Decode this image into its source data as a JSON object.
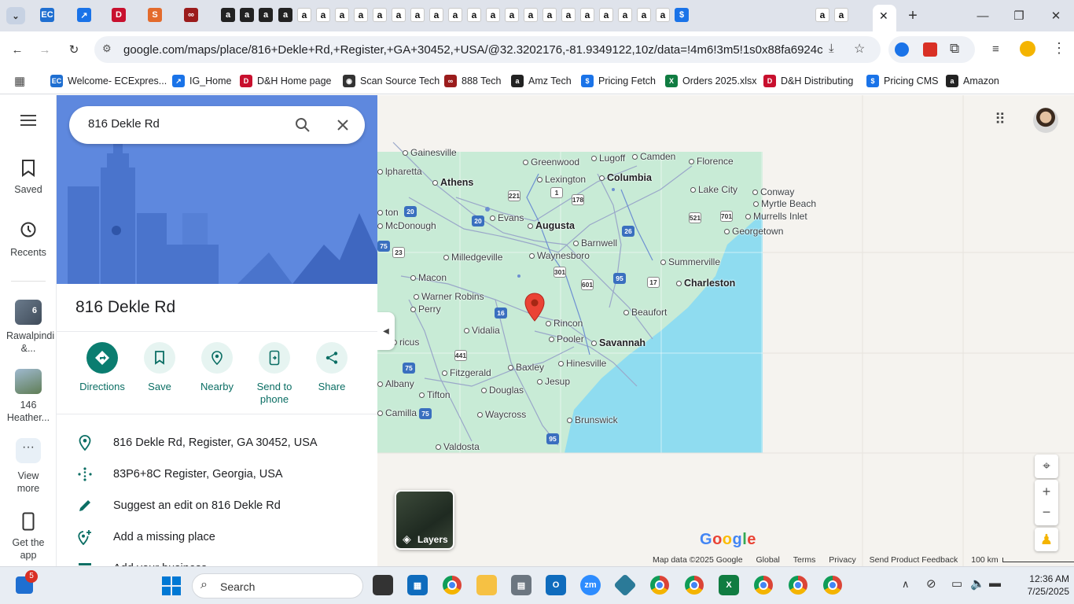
{
  "browser": {
    "tab_favicons": [
      "tab-menu-icon",
      "ec-icon",
      "ig-icon",
      "dh-icon",
      "scansource-icon",
      "888-icon",
      "amazon-icon",
      "amazon-icon",
      "amazon-icon",
      "amazon-icon",
      "amazon-icon",
      "amazon-icon",
      "amazon-icon",
      "amazon-icon",
      "amazon-icon",
      "amazon-icon",
      "amazon-icon",
      "amazon-icon",
      "amazon-icon",
      "amazon-icon",
      "amazon-icon",
      "amazon-icon",
      "amazon-icon",
      "amazon-icon",
      "amazon-icon",
      "amazon-icon",
      "amazon-icon",
      "amazon-icon",
      "amazon-icon",
      "amazon-icon",
      "pricing-icon",
      "amazon-icon",
      "amazon-icon"
    ],
    "url": "google.com/maps/place/816+Dekle+Rd,+Register,+GA+30452,+USA/@32.3202176,-81.9349122,10z/data=!4m6!3m5!1s0x88fa6924ce62d8b3...",
    "bookmarks": [
      {
        "label": "Welcome- ECExpres...",
        "icon": "ec-icon",
        "color": "#1f6fd1"
      },
      {
        "label": "IG_Home",
        "icon": "ig-icon",
        "color": "#1a73e8"
      },
      {
        "label": "D&H Home page",
        "icon": "dh-icon",
        "color": "#c8102e"
      },
      {
        "label": "Scan Source Tech",
        "icon": "scansource-icon",
        "color": "#333333"
      },
      {
        "label": "888 Tech",
        "icon": "888-icon",
        "color": "#9b1c1c"
      },
      {
        "label": "Amz Tech",
        "icon": "amazon-icon",
        "color": "#222222"
      },
      {
        "label": "Pricing Fetch",
        "icon": "pricing-icon",
        "color": "#1a73e8"
      },
      {
        "label": "Orders 2025.xlsx",
        "icon": "excel-icon",
        "color": "#107c41"
      },
      {
        "label": "D&H Distributing",
        "icon": "dh-icon",
        "color": "#c8102e"
      },
      {
        "label": "Pricing CMS",
        "icon": "pricing-icon",
        "color": "#1a73e8"
      },
      {
        "label": "Amazon",
        "icon": "amazon-icon",
        "color": "#222222"
      }
    ]
  },
  "rail": {
    "saved": "Saved",
    "recents": "Recents",
    "recent1_label": "Rawalpindi &...",
    "recent1_badge": "6",
    "recent2_label": "146 Heather...",
    "view_more": "View more",
    "get_app": "Get the app"
  },
  "panel": {
    "search_value": "816 Dekle Rd",
    "place_title": "816 Dekle Rd",
    "actions": [
      {
        "label": "Directions",
        "icon": "directions-icon"
      },
      {
        "label": "Save",
        "icon": "bookmark-icon"
      },
      {
        "label": "Nearby",
        "icon": "nearby-icon"
      },
      {
        "label": "Send to phone",
        "icon": "send-to-phone-icon"
      },
      {
        "label": "Share",
        "icon": "share-icon"
      }
    ],
    "info": [
      {
        "text": "816 Dekle Rd, Register, GA 30452, USA",
        "icon": "location-pin-icon"
      },
      {
        "text": "83P6+8C Register, Georgia, USA",
        "icon": "plus-code-icon"
      },
      {
        "text": "Suggest an edit on 816 Dekle Rd",
        "icon": "pencil-icon"
      },
      {
        "text": "Add a missing place",
        "icon": "add-place-icon"
      },
      {
        "text": "Add your business",
        "icon": "business-icon"
      }
    ]
  },
  "map": {
    "cities": [
      {
        "name": "Gainesville",
        "big": false
      },
      {
        "name": "Greenwood",
        "big": false
      },
      {
        "name": "Lugoff",
        "big": false
      },
      {
        "name": "Camden",
        "big": false
      },
      {
        "name": "Florence",
        "big": false
      },
      {
        "name": "Athens",
        "big": true
      },
      {
        "name": "Lexington",
        "big": false
      },
      {
        "name": "Columbia",
        "big": true
      },
      {
        "name": "Lake City",
        "big": false
      },
      {
        "name": "Conway",
        "big": false
      },
      {
        "name": "Myrtle Beach",
        "big": false
      },
      {
        "name": "Murrells Inlet",
        "big": false
      },
      {
        "name": "Evans",
        "big": false
      },
      {
        "name": "Augusta",
        "big": true
      },
      {
        "name": "McDonough",
        "big": false
      },
      {
        "name": "Georgetown",
        "big": false
      },
      {
        "name": "Barnwell",
        "big": false
      },
      {
        "name": "Milledgeville",
        "big": false
      },
      {
        "name": "Waynesboro",
        "big": false
      },
      {
        "name": "Summerville",
        "big": false
      },
      {
        "name": "Macon",
        "big": false
      },
      {
        "name": "Charleston",
        "big": true
      },
      {
        "name": "Warner Robins",
        "big": false
      },
      {
        "name": "Perry",
        "big": false
      },
      {
        "name": "Beaufort",
        "big": false
      },
      {
        "name": "Rincon",
        "big": false
      },
      {
        "name": "Vidalia",
        "big": false
      },
      {
        "name": "Pooler",
        "big": false
      },
      {
        "name": "Savannah",
        "big": true
      },
      {
        "name": "Hinesville",
        "big": false
      },
      {
        "name": "Fitzgerald",
        "big": false
      },
      {
        "name": "Baxley",
        "big": false
      },
      {
        "name": "Jesup",
        "big": false
      },
      {
        "name": "Albany",
        "big": false
      },
      {
        "name": "Tifton",
        "big": false
      },
      {
        "name": "Douglas",
        "big": false
      },
      {
        "name": "Camilla",
        "big": false
      },
      {
        "name": "Waycross",
        "big": false
      },
      {
        "name": "Brunswick",
        "big": false
      },
      {
        "name": "Valdosta",
        "big": false
      },
      {
        "name": "ricus",
        "big": false
      },
      {
        "name": "ton",
        "big": false
      },
      {
        "name": "lpharetta",
        "big": false
      }
    ],
    "shields": [
      {
        "num": "20",
        "kind": "i"
      },
      {
        "num": "221",
        "kind": "u"
      },
      {
        "num": "1",
        "kind": "u"
      },
      {
        "num": "178",
        "kind": "u"
      },
      {
        "num": "20",
        "kind": "i"
      },
      {
        "num": "521",
        "kind": "u"
      },
      {
        "num": "701",
        "kind": "u"
      },
      {
        "num": "26",
        "kind": "i"
      },
      {
        "num": "75",
        "kind": "i"
      },
      {
        "num": "23",
        "kind": "u"
      },
      {
        "num": "301",
        "kind": "u"
      },
      {
        "num": "95",
        "kind": "i"
      },
      {
        "num": "601",
        "kind": "u"
      },
      {
        "num": "17",
        "kind": "u"
      },
      {
        "num": "16",
        "kind": "i"
      },
      {
        "num": "441",
        "kind": "u"
      },
      {
        "num": "75",
        "kind": "i"
      },
      {
        "num": "75",
        "kind": "i"
      },
      {
        "num": "95",
        "kind": "i"
      }
    ],
    "layers_label": "Layers",
    "google_logo": "Google",
    "footer": {
      "data": "Map data ©2025 Google",
      "global": "Global",
      "terms": "Terms",
      "privacy": "Privacy",
      "feedback": "Send Product Feedback",
      "scale": "100 km"
    }
  },
  "taskbar": {
    "search_placeholder": "Search",
    "notif_badge": "5",
    "time": "12:36 AM",
    "date": "7/25/2025"
  }
}
